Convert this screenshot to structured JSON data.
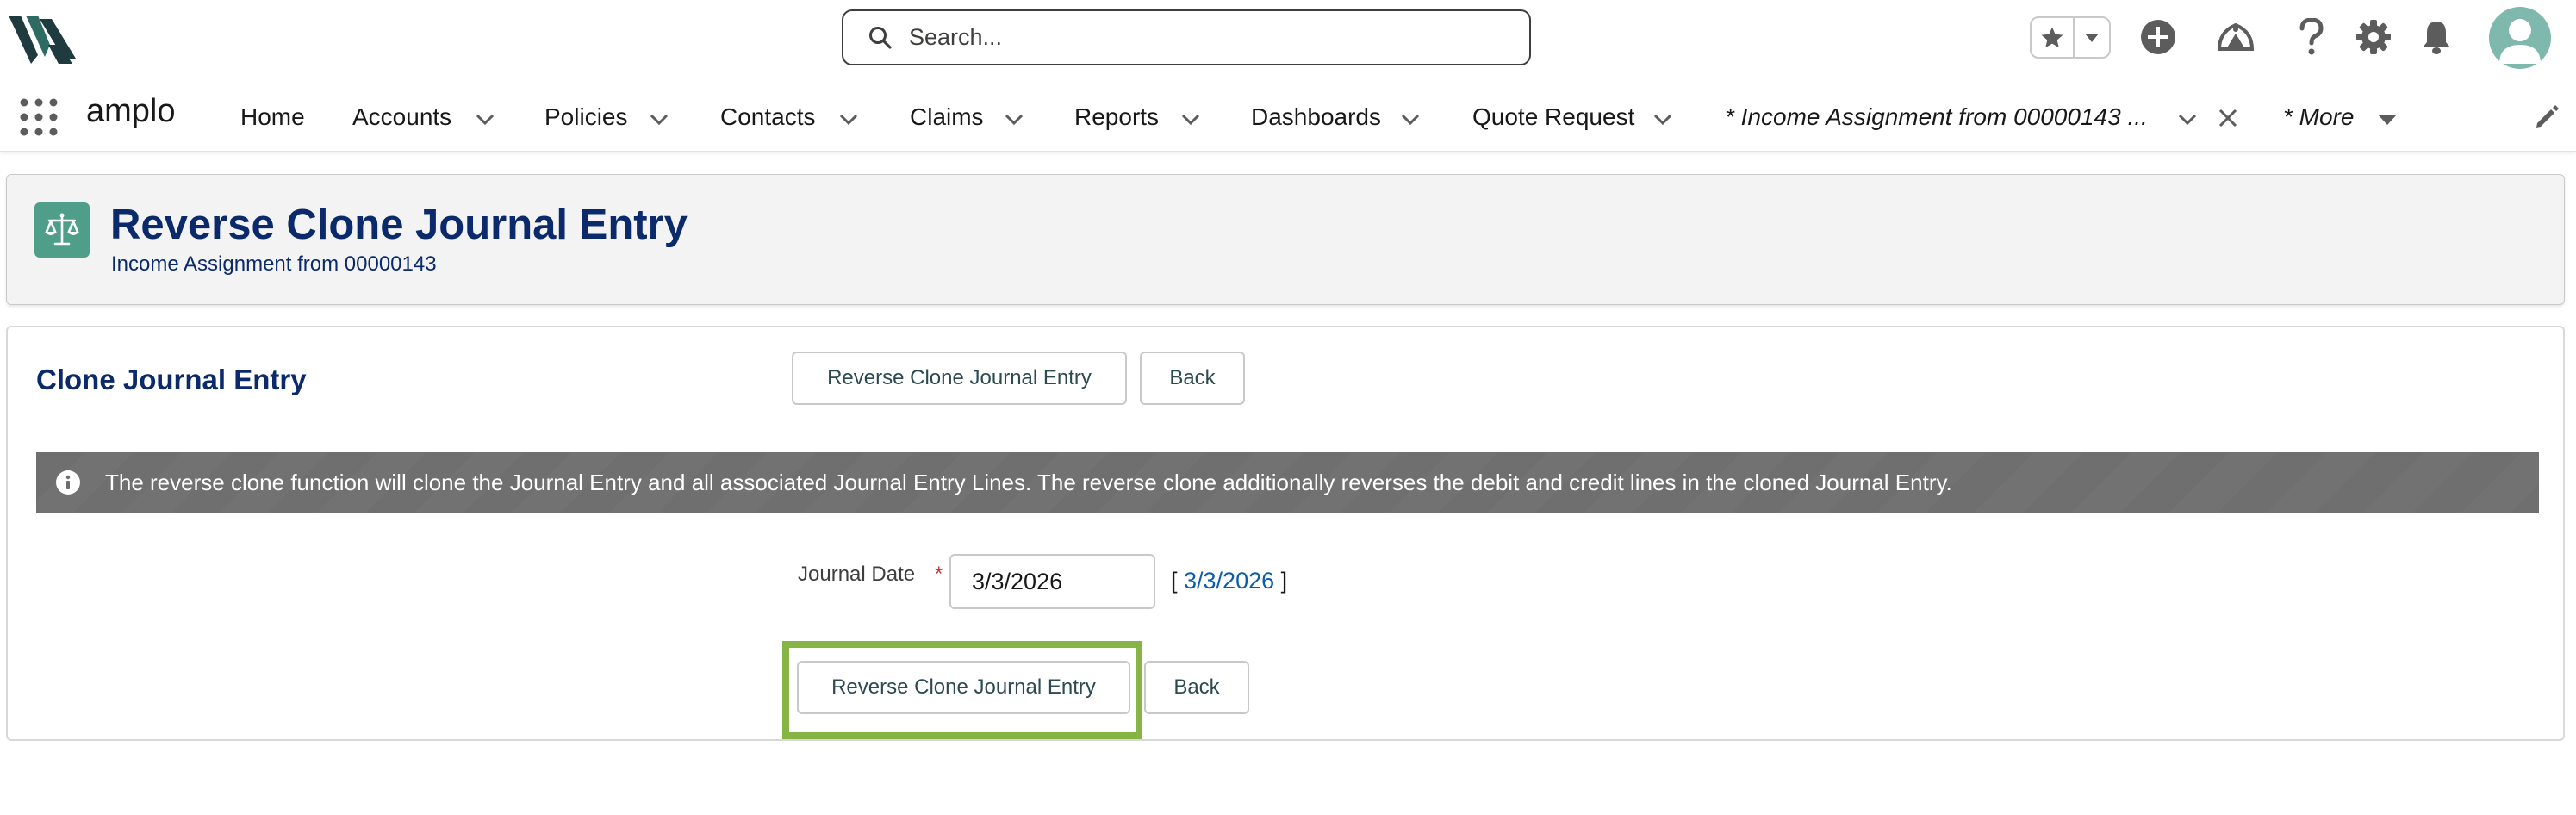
{
  "global_header": {
    "search_placeholder": "Search...",
    "icons": [
      "favorites-star-icon",
      "favorites-dropdown-icon",
      "global-actions-add-icon",
      "trailhead-icon",
      "help-icon",
      "setup-gear-icon",
      "notifications-bell-icon",
      "user-avatar-icon"
    ]
  },
  "nav": {
    "app_name": "amplo",
    "items": [
      {
        "label": "Home"
      },
      {
        "label": "Accounts"
      },
      {
        "label": "Policies"
      },
      {
        "label": "Contacts"
      },
      {
        "label": "Claims"
      },
      {
        "label": "Reports"
      },
      {
        "label": "Dashboards"
      },
      {
        "label": "Quote Request"
      }
    ],
    "active_tab_label": "* Income Assignment from 00000143 ...",
    "more_label": "* More"
  },
  "page_header": {
    "title": "Reverse Clone Journal Entry",
    "subtitle": "Income Assignment from 00000143"
  },
  "main": {
    "section_title": "Clone Journal Entry",
    "top_buttons": {
      "reverse_clone_label": "Reverse Clone Journal Entry",
      "back_label": "Back"
    },
    "info_message": "The reverse clone function will clone the Journal Entry and all associated Journal Entry Lines. The reverse clone additionally reverses the debit and credit lines in the cloned Journal Entry.",
    "journal_date": {
      "label": "Journal Date",
      "required_marker": "*",
      "value": "3/3/2026",
      "today_link_open": "[ ",
      "today_link": "3/3/2026",
      "today_link_close": " ]"
    },
    "bottom_buttons": {
      "reverse_clone_label": "Reverse Clone Journal Entry",
      "back_label": "Back"
    }
  },
  "colors": {
    "title_navy": "#0b2a6b",
    "highlight_green": "#86b545",
    "page_icon_teal": "#4e9e8a",
    "banner_gray": "#706e6b",
    "link_blue": "#0b5cab"
  }
}
